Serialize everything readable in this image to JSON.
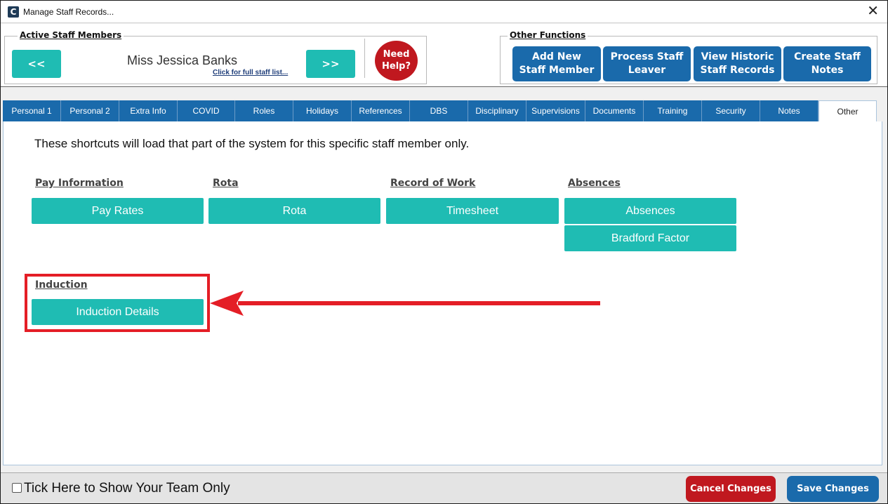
{
  "window": {
    "title": "Manage Staff Records...",
    "app_icon": "C",
    "close_glyph": "✕"
  },
  "active_staff": {
    "legend": "Active Staff Members",
    "prev_label": "<<",
    "next_label": ">>",
    "staff_name": "Miss Jessica Banks",
    "full_list_link": "Click for full staff list...",
    "help_line1": "Need",
    "help_line2": "Help?"
  },
  "other_functions": {
    "legend": "Other Functions",
    "buttons": [
      {
        "line1": "Add New",
        "line2": "Staff Member"
      },
      {
        "line1": "Process Staff",
        "line2": "Leaver"
      },
      {
        "line1": "View Historic",
        "line2": "Staff Records"
      },
      {
        "line1": "Create Staff",
        "line2": "Notes"
      }
    ]
  },
  "tabs": [
    {
      "label": "Personal 1"
    },
    {
      "label": "Personal 2"
    },
    {
      "label": "Extra Info"
    },
    {
      "label": "COVID"
    },
    {
      "label": "Roles"
    },
    {
      "label": "Holidays"
    },
    {
      "label": "References"
    },
    {
      "label": "DBS"
    },
    {
      "label": "Disciplinary"
    },
    {
      "label": "Supervisions"
    },
    {
      "label": "Documents"
    },
    {
      "label": "Training"
    },
    {
      "label": "Security"
    },
    {
      "label": "Notes"
    },
    {
      "label": "Other"
    }
  ],
  "active_tab": "Other",
  "content": {
    "intro": "These shortcuts will load that part of the system for this specific staff member only.",
    "sections": {
      "pay": {
        "label": "Pay Information",
        "buttons": [
          "Pay Rates"
        ]
      },
      "rota": {
        "label": "Rota",
        "buttons": [
          "Rota"
        ]
      },
      "work": {
        "label": "Record of Work",
        "buttons": [
          "Timesheet"
        ]
      },
      "absences": {
        "label": "Absences",
        "buttons": [
          "Absences",
          "Bradford Factor"
        ]
      },
      "induction": {
        "label": "Induction",
        "buttons": [
          "Induction Details"
        ]
      }
    }
  },
  "footer": {
    "team_only_label": "Tick Here to Show Your Team Only",
    "cancel_label": "Cancel Changes",
    "save_label": "Save Changes"
  },
  "colors": {
    "teal": "#1fbcb3",
    "blue": "#1a6aab",
    "red": "#c0181f",
    "annotation_red": "#e41e26"
  }
}
